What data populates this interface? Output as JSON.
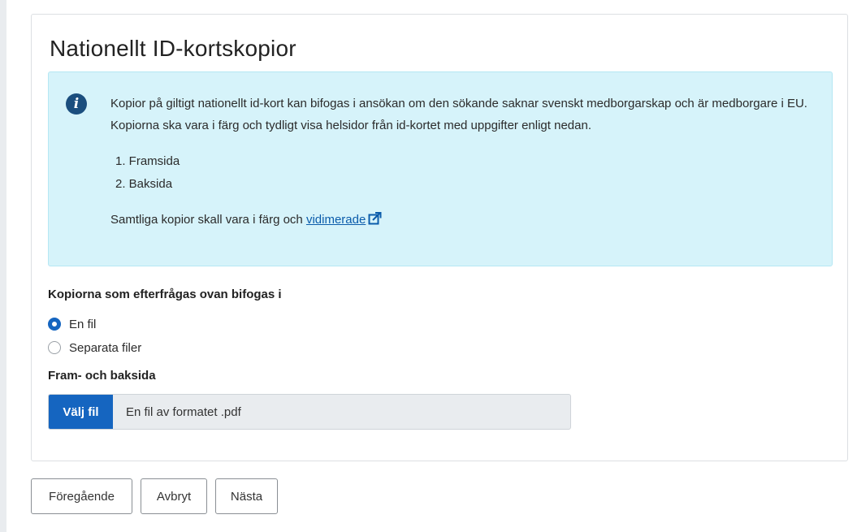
{
  "card": {
    "title": "Nationellt ID-kortskopior"
  },
  "info": {
    "icon": "info-icon",
    "icon_glyph": "i",
    "text": "Kopior på giltigt nationellt id-kort kan bifogas i ansökan om den sökande saknar svenskt medborgarskap och är medborgare i EU. Kopiorna ska vara i färg och tydligt visa helsidor från id-kortet med uppgifter enligt nedan.",
    "list": [
      "1. Framsida",
      "2. Baksida"
    ],
    "note_prefix": "Samtliga kopior skall vara i färg och ",
    "note_link": "vidimerade",
    "link_icon": "external-link-icon"
  },
  "attachment": {
    "label": "Kopiorna som efterfrågas ovan bifogas i",
    "options": [
      {
        "label": "En fil",
        "checked": true
      },
      {
        "label": "Separata filer",
        "checked": false
      }
    ]
  },
  "file": {
    "label": "Fram- och baksida",
    "button": "Välj fil",
    "placeholder": "En fil av formatet .pdf"
  },
  "nav": {
    "previous": "Föregående",
    "cancel": "Avbryt",
    "next": "Nästa"
  },
  "colors": {
    "primary": "#1565c0",
    "info_bg": "#d6f3fa",
    "info_icon": "#1b4e7e",
    "link": "#0b5cab"
  }
}
